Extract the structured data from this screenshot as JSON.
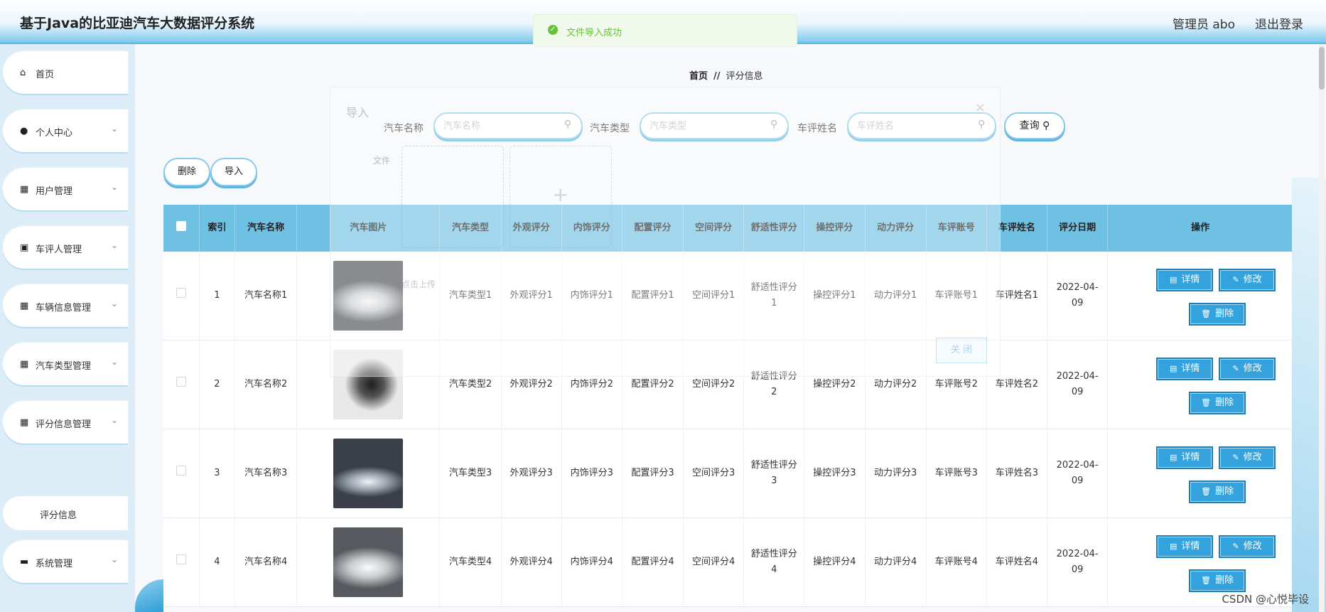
{
  "header": {
    "title": "基于Java的比亚迪汽车大数据评分系统",
    "user": "管理员 abo",
    "logout": "退出登录"
  },
  "toast": {
    "message": "文件导入成功",
    "icon": "check-circle-icon",
    "color": "#67c23a"
  },
  "sidebar": {
    "items": [
      {
        "label": "首页",
        "icon": "home-icon"
      },
      {
        "label": "个人中心",
        "icon": "user-icon"
      },
      {
        "label": "用户管理",
        "icon": "grid-icon"
      },
      {
        "label": "车评人管理",
        "icon": "clipboard-icon"
      },
      {
        "label": "车辆信息管理",
        "icon": "grid-icon"
      },
      {
        "label": "汽车类型管理",
        "icon": "grid-icon"
      },
      {
        "label": "评分信息管理",
        "icon": "grid-icon"
      },
      {
        "label": "系统管理",
        "icon": "briefcase-icon"
      }
    ],
    "active_sub": "评分信息"
  },
  "breadcrumb": {
    "home": "首页",
    "separator": "//",
    "current": "评分信息"
  },
  "search": {
    "fields": [
      {
        "label": "汽车名称",
        "placeholder": "汽车名称",
        "value": ""
      },
      {
        "label": "汽车类型",
        "placeholder": "汽车类型",
        "value": ""
      },
      {
        "label": "车评姓名",
        "placeholder": "车评姓名",
        "value": ""
      }
    ],
    "query_label": "查询"
  },
  "actions": {
    "delete": "删除",
    "import": "导入"
  },
  "dialog": {
    "title": "导入",
    "file_label": "文件",
    "tip": "点击上传",
    "close": "关 闭"
  },
  "table": {
    "headers": [
      "索引",
      "汽车名称",
      "汽车图片",
      "汽车类型",
      "外观评分",
      "内饰评分",
      "配置评分",
      "空间评分",
      "舒适性评分",
      "操控评分",
      "动力评分",
      "车评账号",
      "车评姓名",
      "评分日期",
      "操作"
    ],
    "rows": [
      {
        "index": "1",
        "name": "汽车名称1",
        "type": "汽车类型1",
        "exterior": "外观评分1",
        "interior": "内饰评分1",
        "config": "配置评分1",
        "space": "空间评分1",
        "comfort": "舒适性评分1",
        "handling": "操控评分1",
        "power": "动力评分1",
        "account": "车评账号1",
        "reviewer": "车评姓名1",
        "date": "2022-04-09"
      },
      {
        "index": "2",
        "name": "汽车名称2",
        "type": "汽车类型2",
        "exterior": "外观评分2",
        "interior": "内饰评分2",
        "config": "配置评分2",
        "space": "空间评分2",
        "comfort": "舒适性评分2",
        "handling": "操控评分2",
        "power": "动力评分2",
        "account": "车评账号2",
        "reviewer": "车评姓名2",
        "date": "2022-04-09"
      },
      {
        "index": "3",
        "name": "汽车名称3",
        "type": "汽车类型3",
        "exterior": "外观评分3",
        "interior": "内饰评分3",
        "config": "配置评分3",
        "space": "空间评分3",
        "comfort": "舒适性评分3",
        "handling": "操控评分3",
        "power": "动力评分3",
        "account": "车评账号3",
        "reviewer": "车评姓名3",
        "date": "2022-04-09"
      },
      {
        "index": "4",
        "name": "汽车名称4",
        "type": "汽车类型4",
        "exterior": "外观评分4",
        "interior": "内饰评分4",
        "config": "配置评分4",
        "space": "空间评分4",
        "comfort": "舒适性评分4",
        "handling": "操控评分4",
        "power": "动力评分4",
        "account": "车评账号4",
        "reviewer": "车评姓名4",
        "date": "2022-04-09"
      }
    ],
    "ops": {
      "detail": "详情",
      "edit": "修改",
      "delete": "删除"
    }
  },
  "colors": {
    "header_bg": "#6fc1e4",
    "button_bg": "#33a2dd",
    "accent": "#56b4e3"
  },
  "watermark": "CSDN @心悦毕设"
}
